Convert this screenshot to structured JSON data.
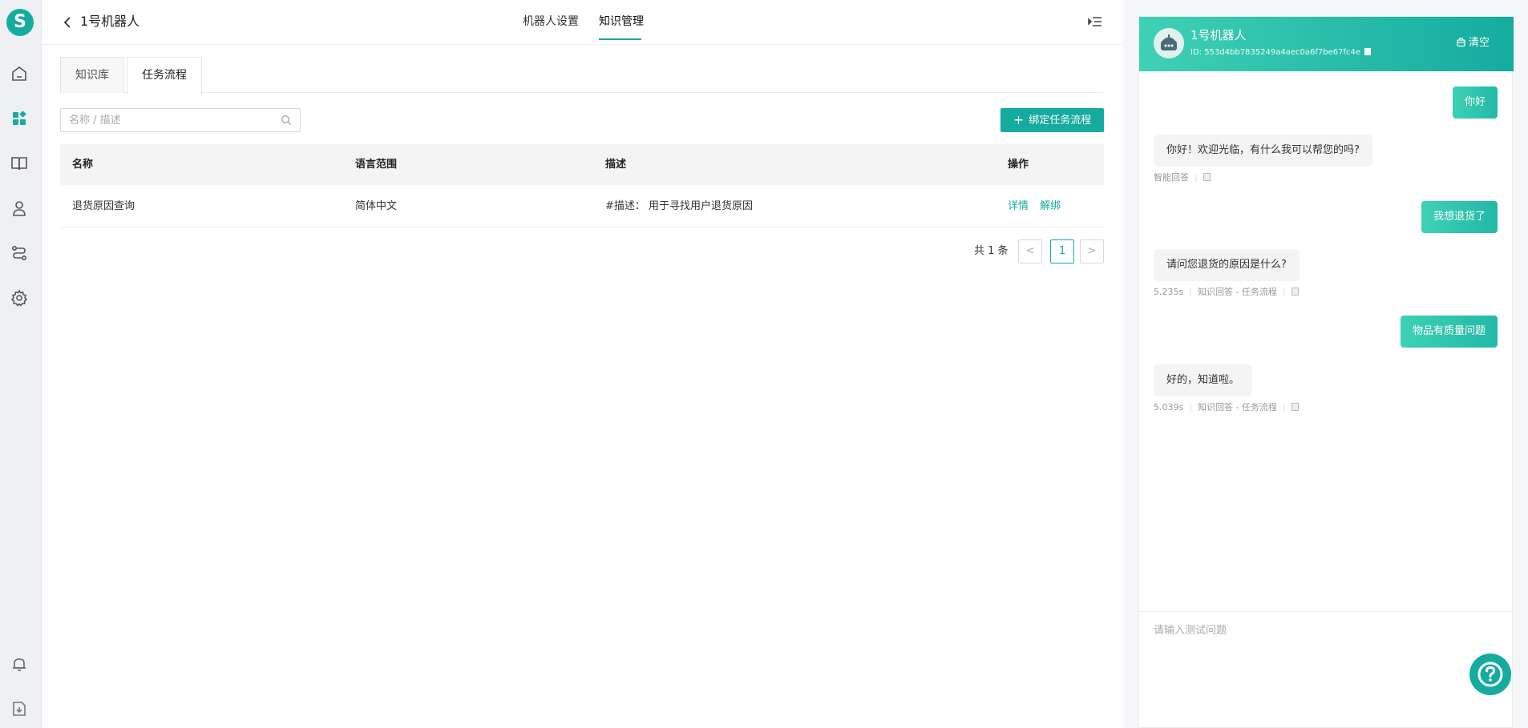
{
  "logo": {
    "letter": "S"
  },
  "header": {
    "robot_name": "1号机器人",
    "tabs": [
      {
        "label": "机器人设置"
      },
      {
        "label": "知识管理"
      }
    ]
  },
  "subtabs": [
    {
      "label": "知识库"
    },
    {
      "label": "任务流程"
    }
  ],
  "search": {
    "placeholder": "名称 / 描述",
    "value": ""
  },
  "toolbar": {
    "bind_label": "绑定任务流程"
  },
  "table": {
    "columns": [
      "名称",
      "语言范围",
      "描述",
      "操作"
    ],
    "rows": [
      {
        "name": "退货原因查询",
        "language": "简体中文",
        "description": "#描述： 用于寻找用户退货原因",
        "actions": [
          "详情",
          "解绑"
        ]
      }
    ]
  },
  "pagination": {
    "total_text": "共 1 条",
    "prev": "<",
    "current": "1",
    "next": ">"
  },
  "chat": {
    "title": "1号机器人",
    "id_text": "ID: 553d4bb7835249a4aec0a6f7be67fc4e",
    "clear_label": "清空",
    "messages": [
      {
        "role": "user",
        "text": "你好"
      },
      {
        "role": "bot",
        "text": "你好！欢迎光临，有什么我可以帮您的吗?",
        "meta_time": "",
        "meta_source": "智能回答"
      },
      {
        "role": "user",
        "text": "我想退货了"
      },
      {
        "role": "bot",
        "text": "请问您退货的原因是什么?",
        "meta_time": "5.235s",
        "meta_source": "知识回答 - 任务流程"
      },
      {
        "role": "user",
        "text": "物品有质量问题"
      },
      {
        "role": "bot",
        "text": "好的，知道啦。",
        "meta_time": "5.039s",
        "meta_source": "知识回答 - 任务流程"
      }
    ],
    "input_placeholder": "请输入测试问题"
  },
  "colors": {
    "accent": "#15ab9f",
    "accent_light": "#3fd1b5"
  }
}
